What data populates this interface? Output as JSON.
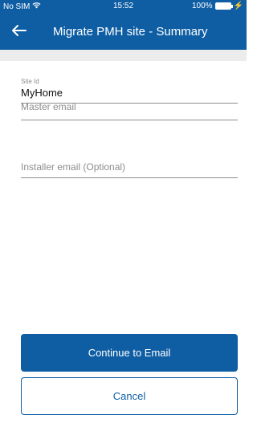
{
  "status_bar": {
    "carrier": "No SIM",
    "time": "15:52",
    "battery": "100%",
    "wifi_icon": "wifi-icon",
    "battery_icon": "battery-icon",
    "charging_icon": "charging-icon"
  },
  "header": {
    "title": "Migrate PMH site - Summary",
    "back_icon": "arrow-left-icon"
  },
  "form": {
    "site_id": {
      "label": "Site Id",
      "value": "MyHome"
    },
    "master_email": {
      "placeholder": "Master email"
    },
    "installer_email": {
      "placeholder": "Installer email (Optional)"
    }
  },
  "actions": {
    "continue_label": "Continue to Email",
    "cancel_label": "Cancel"
  },
  "colors": {
    "primary": "#0f5ea4",
    "band": "#ececec",
    "divider": "#8f8f8f"
  }
}
